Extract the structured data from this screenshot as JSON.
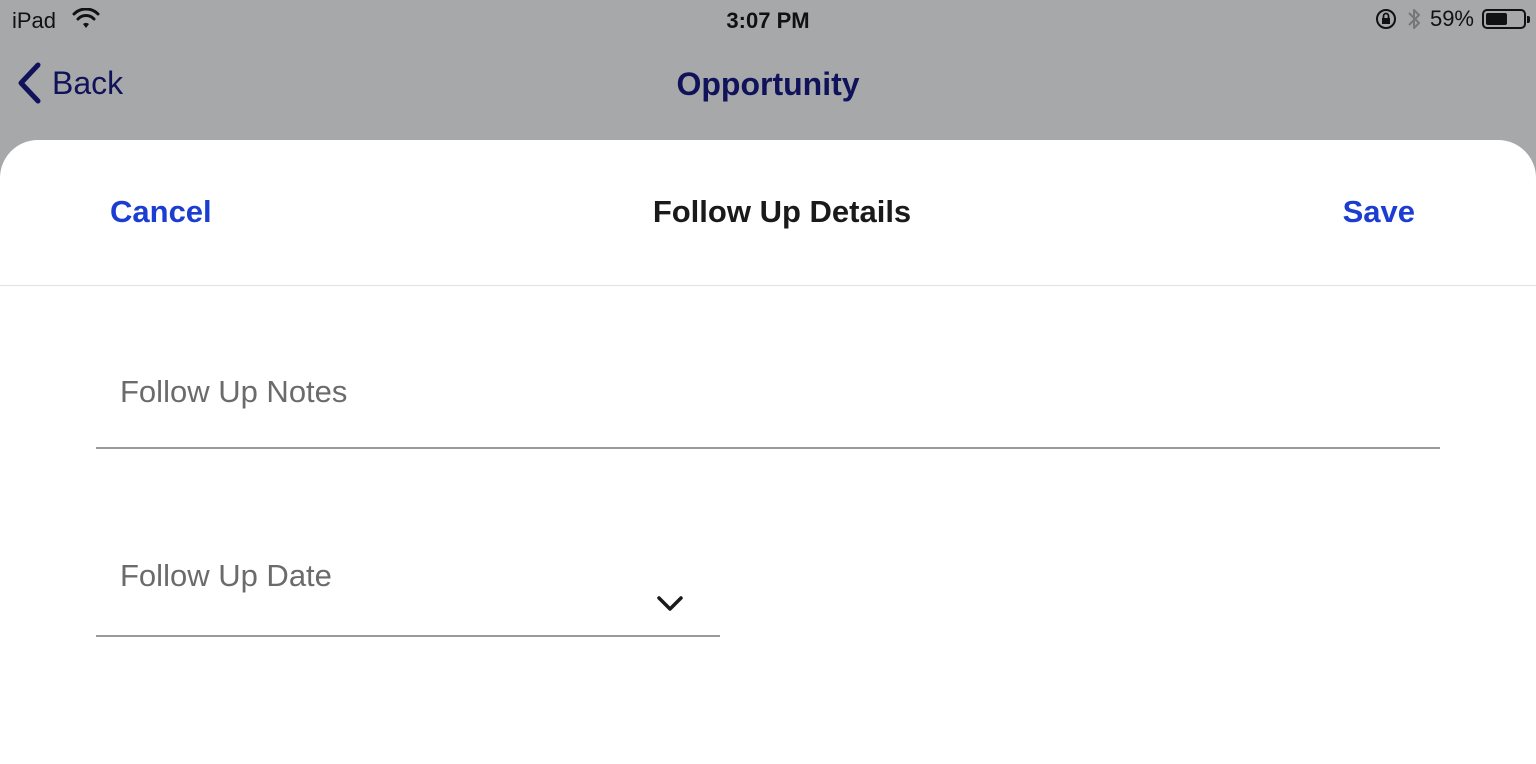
{
  "status_bar": {
    "device": "iPad",
    "time": "3:07 PM",
    "battery_pct": "59%",
    "battery_level": 0.59,
    "icons": [
      "wifi-icon",
      "rotation-lock-icon",
      "bluetooth-icon",
      "battery-icon"
    ]
  },
  "navbar": {
    "back_label": "Back",
    "title": "Opportunity"
  },
  "sheet": {
    "cancel_label": "Cancel",
    "title": "Follow Up Details",
    "save_label": "Save",
    "notes_placeholder": "Follow Up Notes",
    "date_placeholder": "Follow Up Date"
  },
  "colors": {
    "accent": "#1b3dd1",
    "nav_text": "#10125a",
    "dim_background": "#a7a8aa"
  }
}
